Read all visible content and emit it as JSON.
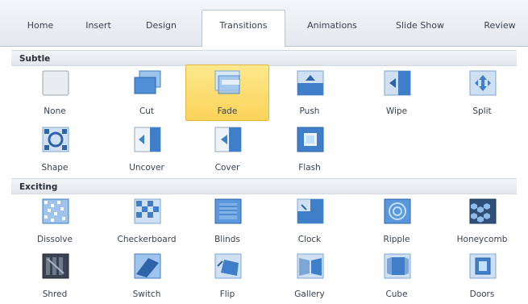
{
  "ribbon": {
    "tabs": [
      {
        "label": "Home",
        "active": false
      },
      {
        "label": "Insert",
        "active": false
      },
      {
        "label": "Design",
        "active": false
      },
      {
        "label": "Transitions",
        "active": true
      },
      {
        "label": "Animations",
        "active": false
      },
      {
        "label": "Slide Show",
        "active": false
      },
      {
        "label": "Review",
        "active": false
      }
    ]
  },
  "gallery": {
    "sections": [
      {
        "title": "Subtle",
        "items": [
          {
            "label": "None",
            "icon": "none-transition-icon",
            "selected": false
          },
          {
            "label": "Cut",
            "icon": "cut-transition-icon",
            "selected": false
          },
          {
            "label": "Fade",
            "icon": "fade-transition-icon",
            "selected": true
          },
          {
            "label": "Push",
            "icon": "push-transition-icon",
            "selected": false
          },
          {
            "label": "Wipe",
            "icon": "wipe-transition-icon",
            "selected": false
          },
          {
            "label": "Split",
            "icon": "split-transition-icon",
            "selected": false
          },
          {
            "label": "Shape",
            "icon": "shape-transition-icon",
            "selected": false
          },
          {
            "label": "Uncover",
            "icon": "uncover-transition-icon",
            "selected": false
          },
          {
            "label": "Cover",
            "icon": "cover-transition-icon",
            "selected": false
          },
          {
            "label": "Flash",
            "icon": "flash-transition-icon",
            "selected": false
          }
        ]
      },
      {
        "title": "Exciting",
        "items": [
          {
            "label": "Dissolve",
            "icon": "dissolve-transition-icon",
            "selected": false
          },
          {
            "label": "Checkerboard",
            "icon": "checkerboard-transition-icon",
            "selected": false
          },
          {
            "label": "Blinds",
            "icon": "blinds-transition-icon",
            "selected": false
          },
          {
            "label": "Clock",
            "icon": "clock-transition-icon",
            "selected": false
          },
          {
            "label": "Ripple",
            "icon": "ripple-transition-icon",
            "selected": false
          },
          {
            "label": "Honeycomb",
            "icon": "honeycomb-transition-icon",
            "selected": false
          },
          {
            "label": "Shred",
            "icon": "shred-transition-icon",
            "selected": false
          },
          {
            "label": "Switch",
            "icon": "switch-transition-icon",
            "selected": false
          },
          {
            "label": "Flip",
            "icon": "flip-transition-icon",
            "selected": false
          },
          {
            "label": "Gallery",
            "icon": "gallery-transition-icon",
            "selected": false
          },
          {
            "label": "Cube",
            "icon": "cube-transition-icon",
            "selected": false
          },
          {
            "label": "Doors",
            "icon": "doors-transition-icon",
            "selected": false
          }
        ]
      }
    ]
  },
  "colors": {
    "selected_fill": "#fbd35a",
    "selected_border": "#e7b640",
    "icon_blue": "#3f7fc9"
  }
}
